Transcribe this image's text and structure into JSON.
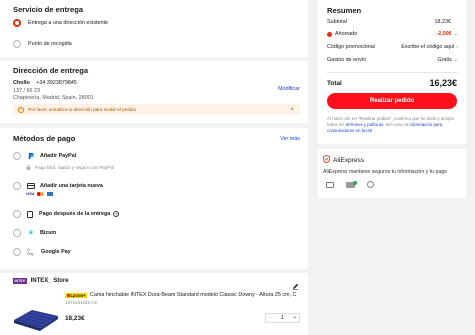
{
  "shipping": {
    "title": "Servicio de entrega",
    "options": [
      {
        "label": "Entrega a una dirección existente",
        "selected": true
      },
      {
        "label": "Punto de recogida",
        "selected": false
      }
    ]
  },
  "address": {
    "title": "Dirección de entrega",
    "name": "Chollo",
    "phone": "+34 3923879845",
    "line1": "137 / 56 23",
    "line2": "Chapinería, Madrid, Spain, 28001",
    "modify_label": "Modificar",
    "warning": "Por favor, actualiza tu dirección para recibir el pedido"
  },
  "payment": {
    "title": "Métodos de pago",
    "see_more": "Ver más",
    "paypal_label": "Añadir PayPal",
    "paypal_note": "Paga fácil, rápido y seguro con PayPal",
    "card_label": "Añadir una tarjeta nueva",
    "card_brands": [
      "VISA",
      "MC",
      "AMEX"
    ],
    "after_label": "Pago después de la entrega",
    "bizum_label": "Bizum",
    "gpay_label": "Google Pay",
    "gpay_mark": "G Pay"
  },
  "store": {
    "badge": "INTEX",
    "name": "INTEX_ Store",
    "tag": "Lpcon+",
    "product_title": "Cama hinchable INTEX Dura-Beam Standard modelo Classic Downy - Altura 25 cm, C",
    "variant": "137x191x25 cm",
    "price": "18,23€",
    "quantity": "1",
    "minus": "−",
    "plus": "+"
  },
  "summary": {
    "title": "Resumen",
    "subtotal_label": "Subtotal",
    "subtotal_value": "18,23€",
    "saved_label": "Ahorrado",
    "saved_value": "-2,00€",
    "promo_label": "Código promocional",
    "promo_value": "Escribe el código aquí",
    "shipping_label": "Gastos de envío",
    "shipping_value": "Gratis",
    "total_label": "Total",
    "total_value": "16,23€",
    "button": "Realizar pedido",
    "legal_1": "Al hacer clic en \"Realizar pedido\", confirmo que he leído y",
    "legal_2": "acepto todos los",
    "legal_link1": "términos y políticas",
    "legal_3": ", así como la",
    "legal_link2": "información",
    "legal_4": "para consumidores en la UE"
  },
  "trust": {
    "brand": "AliExpress",
    "text": "AliExpress mantiene seguros tu información y tu pago"
  },
  "colors": {
    "accent": "#e62e04",
    "button": "#ff0f1b",
    "link": "#1a44c7",
    "warning_bg": "#fff1e6"
  }
}
